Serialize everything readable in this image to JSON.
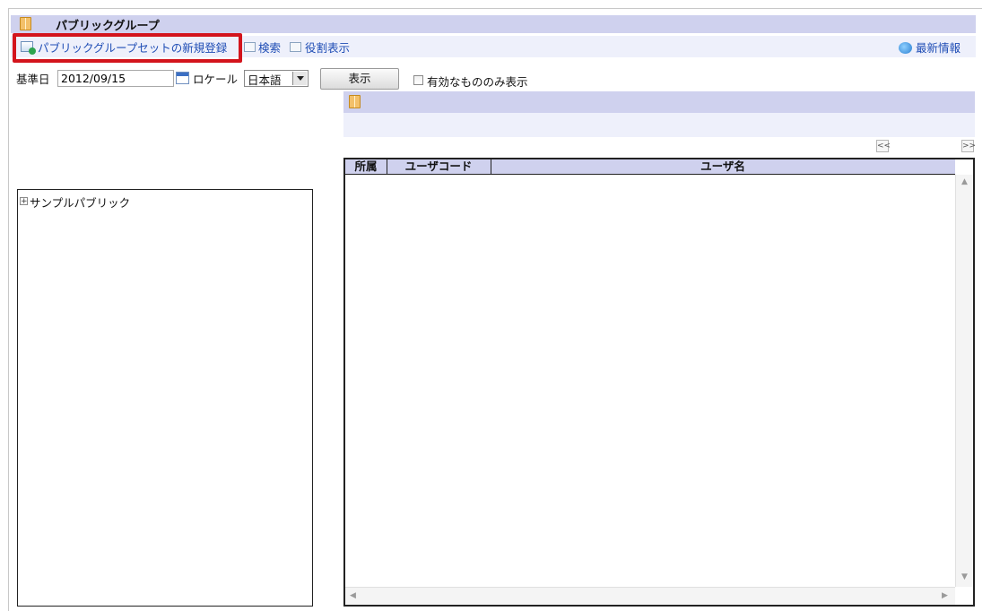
{
  "panel": {
    "title": "パブリックグループ"
  },
  "toolbar": {
    "new_link": "パブリックグループセットの新規登録",
    "search_link": "検索",
    "role_link": "役割表示",
    "refresh_link": "最新情報"
  },
  "filters": {
    "date_label": "基準日",
    "date_value": "2012/09/15",
    "locale_label": "ロケール",
    "locale_value": "日本語",
    "show_button": "表示",
    "active_only_label": "有効なもののみ表示",
    "active_only_checked": false
  },
  "pager": {
    "prev": "<<",
    "next": ">>"
  },
  "tree": {
    "expand_glyph": "+",
    "root": {
      "label": "サンプルパブリック"
    }
  },
  "grid": {
    "columns": [
      "所属",
      "ユーザコード",
      "ユーザ名"
    ],
    "rows": []
  },
  "colors": {
    "header_bg": "#cfd1ee",
    "toolbar_bg": "#eef0fb",
    "link": "#1f4db5",
    "highlight": "#d3141c"
  }
}
